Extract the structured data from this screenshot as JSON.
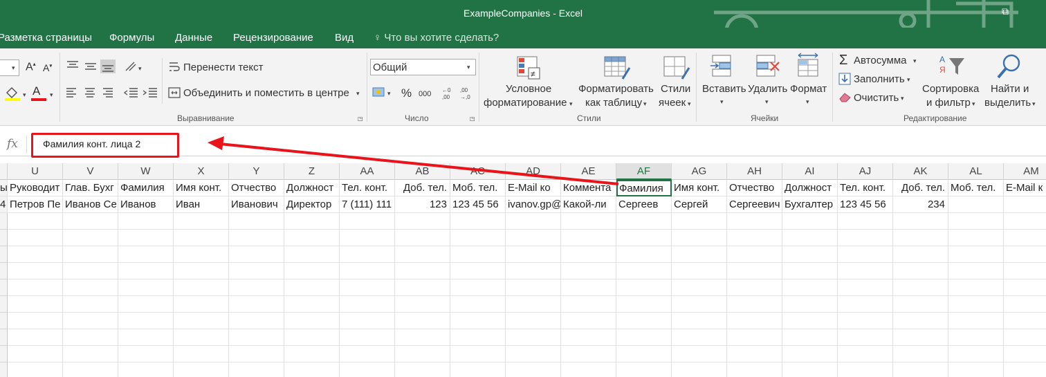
{
  "window": {
    "title": "ExampleCompanies - Excel"
  },
  "menu": {
    "tabs": [
      "Разметка страницы",
      "Формулы",
      "Данные",
      "Рецензирование",
      "Вид"
    ],
    "tell_me": "Что вы хотите сделать?"
  },
  "ribbon": {
    "alignment": {
      "wrap_text": "Перенести текст",
      "merge_center": "Объединить и поместить в центре",
      "label": "Выравнивание"
    },
    "number": {
      "format": "Общий",
      "percent": "%",
      "thousands": "000",
      "label": "Число"
    },
    "styles": {
      "conditional_1": "Условное",
      "conditional_2": "форматирование",
      "format_table_1": "Форматировать",
      "format_table_2": "как таблицу",
      "cell_styles_1": "Стили",
      "cell_styles_2": "ячеек",
      "label": "Стили"
    },
    "cells": {
      "insert": "Вставить",
      "delete": "Удалить",
      "format": "Формат",
      "label": "Ячейки"
    },
    "editing": {
      "autosum": "Автосумма",
      "fill": "Заполнить",
      "clear": "Очистить",
      "sort_1": "Сортировка",
      "sort_2": "и фильтр",
      "find_1": "Найти и",
      "find_2": "выделить",
      "label": "Редактирование"
    }
  },
  "formula_bar": {
    "fx": "fx",
    "value": "Фамилия конт. лица 2"
  },
  "grid": {
    "columns": [
      "U",
      "V",
      "W",
      "X",
      "Y",
      "Z",
      "AA",
      "AB",
      "AC",
      "AD",
      "AE",
      "AF",
      "AG",
      "AH",
      "AI",
      "AJ",
      "AK",
      "AL",
      "AM"
    ],
    "selected_column": "AF",
    "row1": [
      "ый",
      "Руководит",
      "Глав. Бухг",
      "Фамилия",
      "Имя конт.",
      "Отчество",
      "Должност",
      "Тел. конт.",
      "Доб. тел.",
      "Моб. тел.",
      "E-Mail ко",
      "Коммента",
      "Фамилия",
      "Имя конт.",
      "Отчество",
      "Должност",
      "Тел. конт.",
      "Доб. тел.",
      "Моб. тел.",
      "E-Mail к"
    ],
    "row2": [
      "4",
      "Петров Пе",
      "Иванов Се",
      "Иванов",
      "Иван",
      "Иванович",
      "Директор",
      "7 (111) 111",
      "123",
      "123 45 56",
      "ivanov.gp@",
      "Какой-ли",
      "Сергеев",
      "Сергей",
      "Сергеевич",
      "Бухгалтер",
      "123 45 56",
      "234",
      "",
      ""
    ]
  },
  "colors": {
    "accent": "#217346",
    "highlight": "#e8141a"
  }
}
